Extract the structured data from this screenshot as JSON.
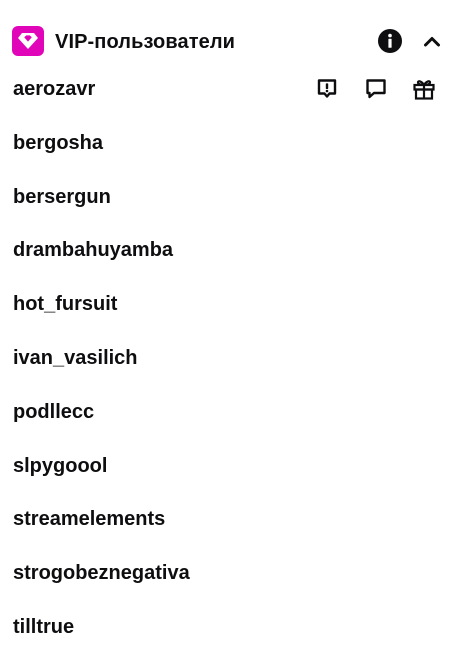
{
  "header": {
    "title": "VIP-пользователи",
    "badge_icon": "vip-diamond-icon",
    "badge_color": "#e005b9",
    "info_icon": "info-icon",
    "collapse_icon": "chevron-up-icon"
  },
  "row_actions": {
    "icons": [
      "report-message-icon",
      "whisper-icon",
      "gift-sub-icon"
    ]
  },
  "users": [
    {
      "name": "aerozavr"
    },
    {
      "name": "bergosha"
    },
    {
      "name": "bersergun"
    },
    {
      "name": "drambahuyamba"
    },
    {
      "name": "hot_fursuit"
    },
    {
      "name": "ivan_vasilich"
    },
    {
      "name": "podllecc"
    },
    {
      "name": "slpygoool"
    },
    {
      "name": "streamelements"
    },
    {
      "name": "strogobeznegativa"
    },
    {
      "name": "tilltrue"
    }
  ]
}
